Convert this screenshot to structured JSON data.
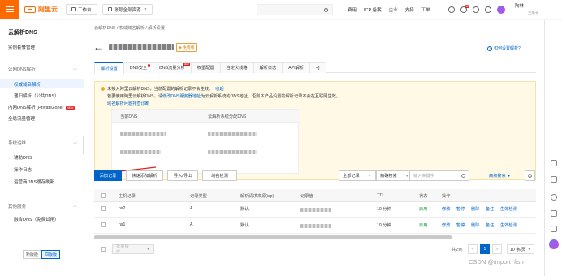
{
  "topbar": {
    "logo": "阿里云",
    "workbench": "工作台",
    "account_scope": "账号全部资源",
    "links": [
      "费用",
      "ICP 备案",
      "企业",
      "支持",
      "工单"
    ],
    "notif_count": "12",
    "user_name": "陶林",
    "user_sub": "主账号"
  },
  "sidebar": {
    "title": "云解析DNS",
    "items": [
      {
        "label": "实例套餐管理"
      },
      {
        "label": "公网DNS解析"
      },
      {
        "label": "权威域名解析"
      },
      {
        "label": "递归解析（公共DNS）"
      },
      {
        "label": "内网DNS解析 (PrivateZone)",
        "tag": "NEW"
      },
      {
        "label": "全局流量管理"
      },
      {
        "label": "系统运维"
      },
      {
        "label": "辅助DNS"
      },
      {
        "label": "操作日志"
      },
      {
        "label": "运营商DNS缓存刷新"
      },
      {
        "label": "其他服务"
      },
      {
        "label": "融合DNS（免费试用）"
      }
    ],
    "switch": [
      "新版版",
      "四版版"
    ]
  },
  "main": {
    "breadcrumb": "云解析DNS  /  权威域名解析  /  解析设置",
    "free_tag": "免费版",
    "help_link": "如何设置解析?",
    "tabs": [
      {
        "label": "解析设置",
        "active": true
      },
      {
        "label": "DNS安全",
        "dot": true
      },
      {
        "label": "DNS流量分析",
        "new": "NEW"
      },
      {
        "label": "权重配置"
      },
      {
        "label": "自定义线路"
      },
      {
        "label": "解析日志"
      },
      {
        "label": "API解析"
      },
      {
        "label": "<]"
      }
    ],
    "alert": {
      "line1": "未接入阿里云解析DNS，当前配置的解析记录不会生效。",
      "line1_link": "收起",
      "line2_pre": "若要使用阿里云解析DNS，请",
      "line2_link": "修改DNS服务器地址",
      "line2_post": "为云解析系统的DNS地址，否则本产品设置的解析记录不会在互联网生效。",
      "line3": "域名解析问题排查诊断",
      "col1": "当前DNS",
      "col2": "云解析系统分配DNS"
    },
    "toolbar": {
      "add": "添加记录",
      "quick": "快速添加解析",
      "import": "导入/导出",
      "wildcard": "域名检测",
      "record_filter": "全部记录",
      "search_type": "精确搜索",
      "search_placeholder": "输入关键字",
      "advanced": "高级搜索"
    },
    "table": {
      "headers": [
        "主机记录",
        "记录类型",
        "解析请求来源(isp)",
        "记录值",
        "TTL",
        "状态",
        "操作"
      ],
      "rows": [
        {
          "host": "ns2",
          "type": "A",
          "isp": "默认",
          "ttl": "10 分钟",
          "status": "启用",
          "ops": [
            "修改",
            "暂停",
            "删除",
            "备注",
            "生效检测"
          ]
        },
        {
          "host": "ns1",
          "type": "A",
          "isp": "默认",
          "ttl": "10 分钟",
          "status": "启用",
          "ops": [
            "修改",
            "暂停",
            "删除",
            "备注",
            "生效检测"
          ]
        }
      ]
    },
    "footer": {
      "batch": "批量操作",
      "total": "共2条",
      "prev": "<",
      "page": "1",
      "next": ">",
      "per_page": "10 条/页"
    }
  },
  "watermark": "CSDN @import_fish"
}
